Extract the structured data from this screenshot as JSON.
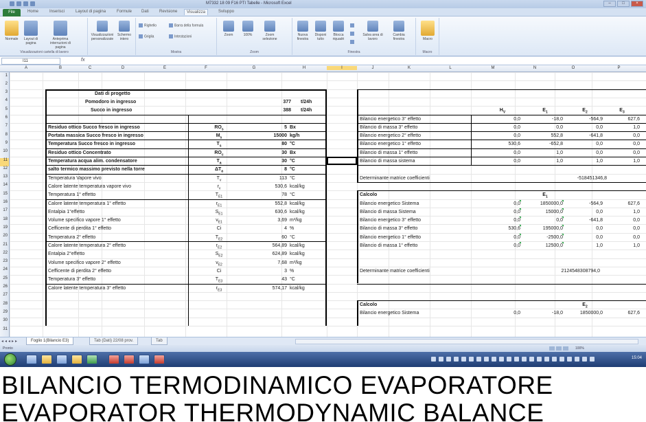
{
  "window": {
    "title": "M7332 18 09 F16 PTI Tabelle - Microsoft Excel"
  },
  "ribbon_tabs": [
    "File",
    "Home",
    "Inserisci",
    "Layout di pagina",
    "Formule",
    "Dati",
    "Revisione",
    "Visualizza",
    "Sviluppo"
  ],
  "ribbon_active_tab": "Visualizza",
  "ribbon_labels": {
    "normale": "Normale",
    "layout": "Layout di pagina",
    "anteprima": "Anteprima interruzioni di pagina",
    "personalizzate": "Visualizzazioni personalizzate",
    "schermo": "Schermo intero",
    "righello": "Righello",
    "barra_formula": "Barra della formula",
    "griglia": "Griglia",
    "intestazioni": "Intestazioni",
    "zoom": "Zoom",
    "cento": "100%",
    "zoom_sel": "Zoom selezione",
    "nuova": "Nuova finestra",
    "disponi": "Disponi tutto",
    "blocca": "Blocca riquadri",
    "salva": "Salva area di lavoro",
    "cambia": "Cambia finestra",
    "macro": "Macro",
    "grp_vis": "Visualizzazioni cartella di lavoro",
    "grp_mostra": "Mostra",
    "grp_zoom": "Zoom",
    "grp_finestra": "Finestra",
    "grp_macro": "Macro"
  },
  "formula_bar": {
    "name_box": "I11",
    "fx": "fx"
  },
  "columns": [
    "A",
    "B",
    "C",
    "D",
    "E",
    "F",
    "G",
    "H",
    "I",
    "J",
    "K",
    "L",
    "M",
    "N",
    "O",
    "P"
  ],
  "selected_column": "I",
  "selected_row": "11",
  "left_block": {
    "header": {
      "title": "Dati di progetto",
      "row1": {
        "label": "Pomodoro in ingresso",
        "value": "377",
        "unit": "t/24h"
      },
      "row2": {
        "label": "Succo in ingresso",
        "value": "388",
        "unit": "t/24h"
      }
    },
    "rows": [
      {
        "label": "Residuo ottico Succo fresco in ingresso",
        "sym": "RO",
        "sub": "s",
        "val": "5",
        "unit": "Bx",
        "bold": true
      },
      {
        "label": "Portata massica Succo fresco in ingresso",
        "sym": "M",
        "sub": "s",
        "val": "15000",
        "unit": "kg/h",
        "bold": true
      },
      {
        "label": "Temperatura Succo fresco in ingresso",
        "sym": "T",
        "sub": "s",
        "val": "80",
        "unit": "°C",
        "bold": true
      },
      {
        "label": "Residuo ottico Concentrato",
        "sym": "RO",
        "sub": "c",
        "val": "30",
        "unit": "Bx",
        "bold": true
      },
      {
        "label": "Temperatura acqua alim. condensatore",
        "sym": "T",
        "sub": "a",
        "val": "30",
        "unit": "°C",
        "bold": true
      },
      {
        "label": "salto termico massimo previsto nella torre",
        "sym": "ΔT",
        "sub": "a",
        "val": "8",
        "unit": "°C",
        "bold": true
      },
      {
        "label": "Temperatura Vapore vivo",
        "sym": "T",
        "sub": "v",
        "val": "113",
        "unit": "°C",
        "bold": false
      },
      {
        "label": "Calore latente temperatura vapore vivo",
        "sym": "r",
        "sub": "v",
        "val": "530,6",
        "unit": "kcal/kg",
        "bold": false
      },
      {
        "label": "Temperatura 1° effetto",
        "sym": "T",
        "sub": "E1",
        "val": "78",
        "unit": "°C",
        "bold": false
      },
      {
        "label": "Calore latente temperatura 1° effetto",
        "sym": "r",
        "sub": "E1",
        "val": "552,8",
        "unit": "kcal/kg",
        "bold": false
      },
      {
        "label": "Entalpia 1°effetto",
        "sym": "S",
        "sub": "E1",
        "val": "630,6",
        "unit": "kcal/kg",
        "bold": false
      },
      {
        "label": "Volume specifico vapore 1° effetto",
        "sym": "v",
        "sub": "E1",
        "val": "3,69",
        "unit": "m³/kg",
        "bold": false
      },
      {
        "label": "Cefficente di perdita 1° effetto",
        "sym": "Ci",
        "sub": "",
        "val": "4",
        "unit": "%",
        "bold": false
      },
      {
        "label": "Temperatura 2° effetto",
        "sym": "T",
        "sub": "E2",
        "val": "60",
        "unit": "°C",
        "bold": false
      },
      {
        "label": "Calore latente temperatura 2° effetto",
        "sym": "r",
        "sub": "E2",
        "val": "564,89",
        "unit": "kcal/kg",
        "bold": false
      },
      {
        "label": "Entalpia 2°effetto",
        "sym": "S",
        "sub": "E2",
        "val": "624,89",
        "unit": "kcal/kg",
        "bold": false
      },
      {
        "label": "Volume specifico vapore 2° effetto",
        "sym": "v",
        "sub": "E2",
        "val": "7,68",
        "unit": "m³/kg",
        "bold": false
      },
      {
        "label": "Cefficente di perdita 2° effetto",
        "sym": "Ci",
        "sub": "",
        "val": "3",
        "unit": "%",
        "bold": false
      },
      {
        "label": "Temperatura 3° effetto",
        "sym": "T",
        "sub": "E3",
        "val": "43",
        "unit": "°C",
        "bold": false
      },
      {
        "label": "Calore latente temperatura 3° effetto",
        "sym": "r",
        "sub": "E3",
        "val": "574,17",
        "unit": "kcal/kg",
        "bold": false
      }
    ]
  },
  "right_block": {
    "headers": [
      "H",
      "E",
      "E",
      "E"
    ],
    "header_subs": [
      "V",
      "1",
      "2",
      "3"
    ],
    "balance": [
      {
        "label": "Bilancio energetico 3° effetto",
        "vals": [
          "0,0",
          "-18,0",
          "-564,9",
          "627,6"
        ]
      },
      {
        "label": "Bilancio di massa 3° effetto",
        "vals": [
          "0,0",
          "0,0",
          "0,0",
          "1,0"
        ]
      },
      {
        "label": "Bilancio energetico 2° effetto",
        "vals": [
          "0,0",
          "552,8",
          "-641,8",
          "0,0"
        ]
      },
      {
        "label": "Bilancio energetico 1° effetto",
        "vals": [
          "530,6",
          "-652,8",
          "0,0",
          "0,0"
        ]
      },
      {
        "label": "Bilancio di massa 1° effetto",
        "vals": [
          "0,0",
          "1,0",
          "0,0",
          "0,0"
        ]
      },
      {
        "label": "Bilancio di massa sistema",
        "vals": [
          "0,0",
          "1,0",
          "1,0",
          "1,0"
        ]
      }
    ],
    "det1_label": "Determinante matrice coefficienti",
    "det1_value": "-518451346,8",
    "calc1": {
      "title": "Calcolo",
      "col_header": "E",
      "col_sub": "1",
      "rows": [
        {
          "label": "Bilancio energetico Sistema",
          "vals": [
            "0,0",
            "1850000,0",
            "-564,9",
            "627,6"
          ]
        },
        {
          "label": "Bilancio di massa Sistema",
          "vals": [
            "0,0",
            "15000,0",
            "0,0",
            "1,0"
          ]
        },
        {
          "label": "Bilancio energetico 3° effetto",
          "vals": [
            "0,0",
            "0,0",
            "-641,8",
            "0,0"
          ]
        },
        {
          "label": "Bilancio di massa 3° effetto",
          "vals": [
            "530,6",
            "195000,0",
            "0,0",
            "0,0"
          ]
        },
        {
          "label": "Bilancio energetico 1° effetto",
          "vals": [
            "0,0",
            "-2500,0",
            "0,0",
            "0,0"
          ]
        },
        {
          "label": "Bilancio di massa 1° effetto",
          "vals": [
            "0,0",
            "12500,0",
            "1,0",
            "1,0"
          ]
        }
      ]
    },
    "det2_label": "Determinante matrice coefficienti",
    "det2_value": "2124548308794,0",
    "calc2": {
      "title": "Calcolo",
      "col_header": "E",
      "col_sub": "2",
      "partial": {
        "label": "Bilancio energetico Sistema",
        "vals": [
          "0,0",
          "-18,0",
          "1850000,0",
          "627,6"
        ]
      }
    }
  },
  "sheet_tabs": [
    "Foglio 1(Bilancio E3)",
    "Tab (Dati) 22/08 prov.",
    "Tab"
  ],
  "status": {
    "ready": "Pronto",
    "zoom": "100%"
  },
  "taskbar": {
    "clock": "15:04"
  },
  "caption": {
    "line1": "BILANCIO TERMODINAMICO EVAPORATORE",
    "line2": "EVAPORATOR THERMODYNAMIC BALANCE"
  }
}
